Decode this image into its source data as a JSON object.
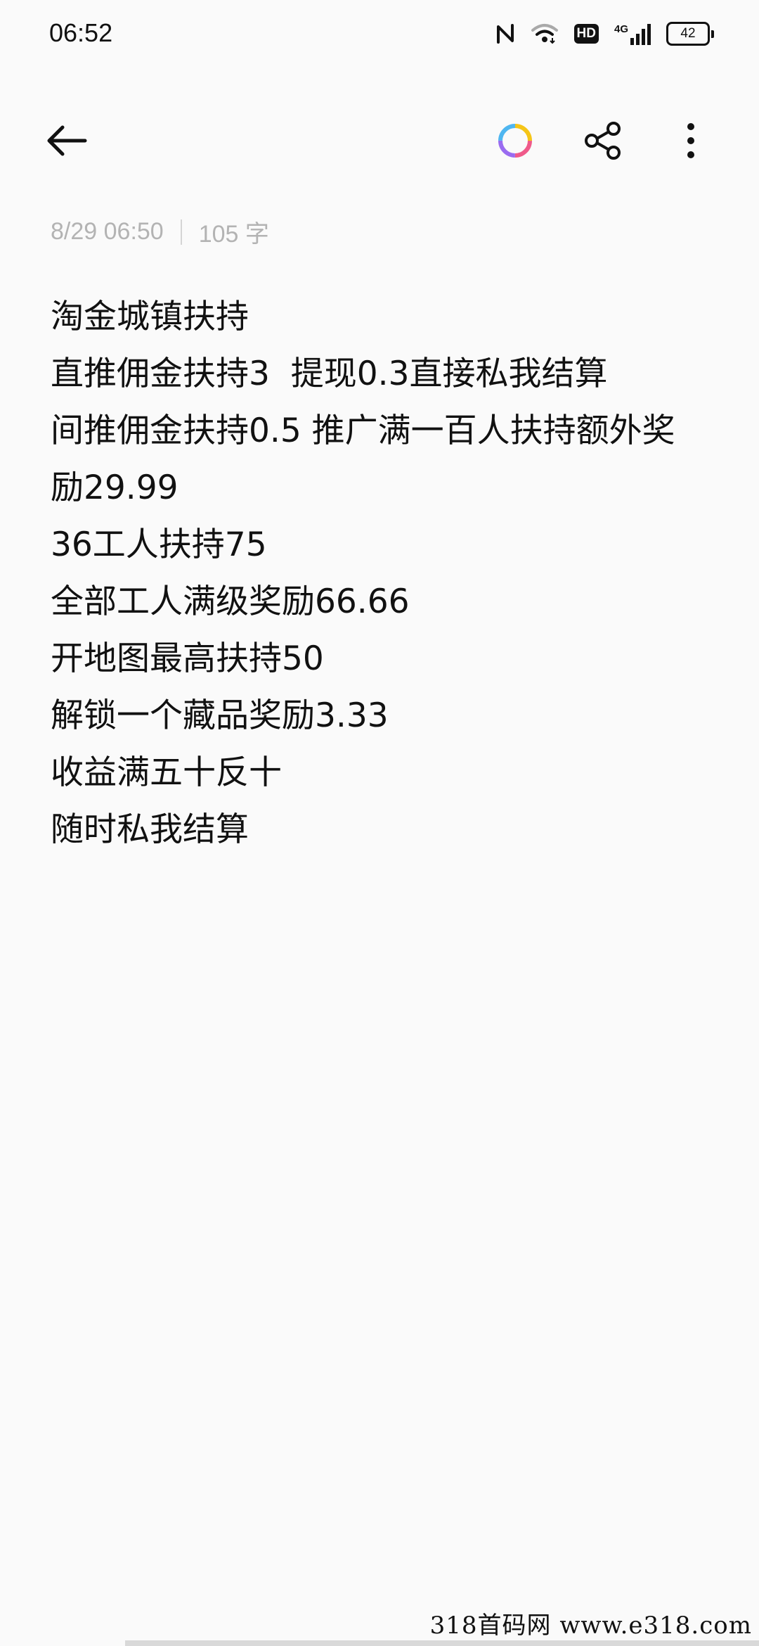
{
  "status_bar": {
    "time": "06:52",
    "icons": [
      "nfc-icon",
      "wifi-icon",
      "hd-badge",
      "4g-signal-icon",
      "battery-icon"
    ],
    "hd_label": "HD",
    "network_label": "4G",
    "battery_level": "42"
  },
  "toolbar": {
    "back_icon": "arrow-left-icon",
    "theme_icon": "color-ring-icon",
    "share_icon": "share-icon",
    "more_icon": "vertical-dots-icon"
  },
  "note": {
    "date": "8/29 06:50",
    "word_count": "105 字",
    "lines": [
      "淘金城镇扶持",
      "直推佣金扶持3  提现0.3直接私我结算",
      "间推佣金扶持0.5 推广满一百人扶持额外奖励29.99",
      "36工人扶持75",
      "全部工人满级奖励66.66",
      "开地图最高扶持50",
      "解锁一个藏品奖励3.33",
      "收益满五十反十",
      "随时私我结算"
    ]
  },
  "watermark": "318首码网  www.e318.com",
  "colors": {
    "background": "#fafafa",
    "text": "#111111",
    "meta_text": "#b3b3b3"
  }
}
